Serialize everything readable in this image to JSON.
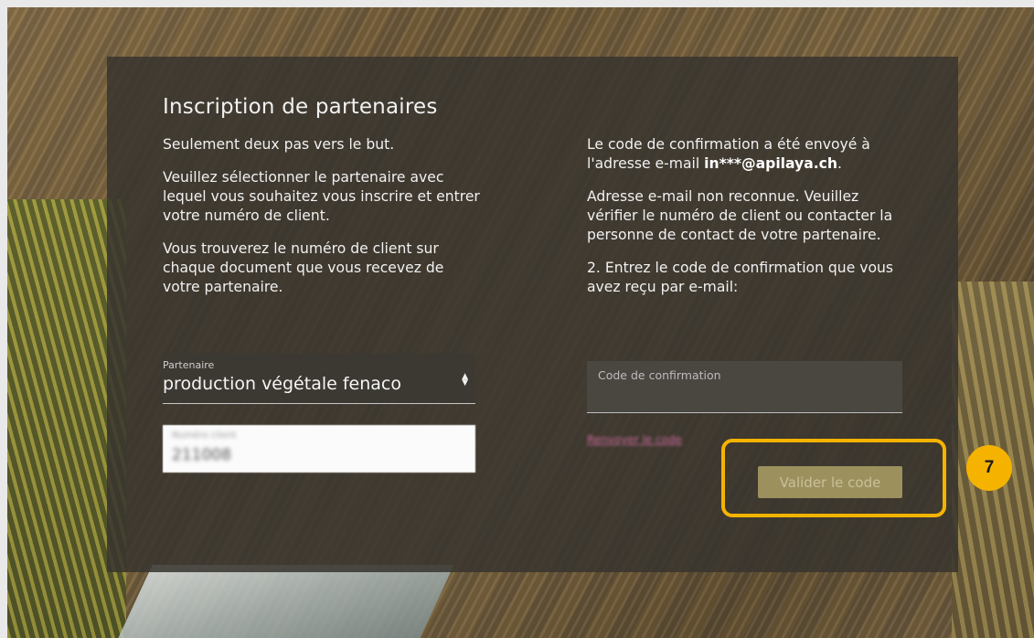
{
  "panel": {
    "title": "Inscription de partenaires",
    "left": {
      "intro": "Seulement deux pas vers le but.",
      "instructions": "Veuillez sélectionner le partenaire avec lequel vous souhaitez vous inscrire et entrer votre numéro de client.",
      "hint": "Vous trouverez le numéro de client sur chaque document que vous recevez de votre partenaire."
    },
    "right": {
      "sent_prefix": "Le code de confirmation a été envoyé à l'adresse e-mail ",
      "sent_email": "in***@apilaya.ch",
      "sent_suffix": ".",
      "not_recognized": "Adresse e-mail non reconnue. Veuillez vérifier le numéro de client ou contacter la personne de contact de votre partenaire.",
      "step2": "2. Entrez le code de confirmation que vous avez reçu par e-mail:"
    }
  },
  "form": {
    "partner_label": "Partenaire",
    "partner_value": "production végétale fenaco",
    "client_label": "Numéro client",
    "client_value": "211008",
    "code_label": "Code de confirmation",
    "code_value": "",
    "resend_link": "Renvoyer le code",
    "validate_button": "Valider le code"
  },
  "annotation": {
    "step_number": "7",
    "highlight_color": "#f5b300"
  },
  "icons": {
    "select_arrows": "sort-updown-icon"
  }
}
